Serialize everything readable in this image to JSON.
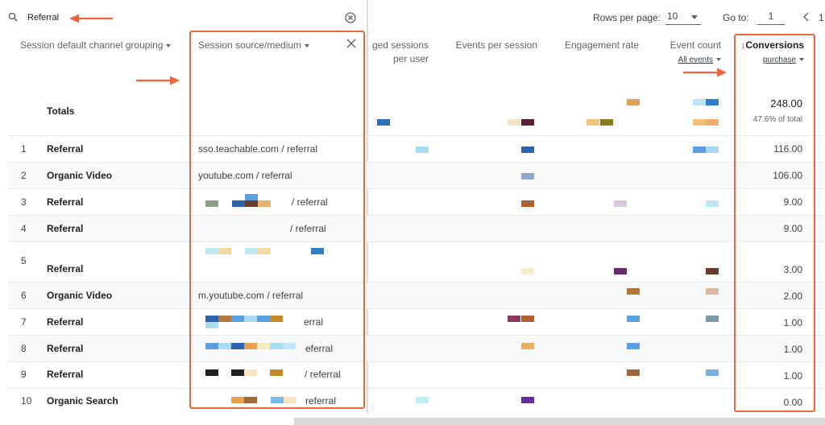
{
  "search": {
    "value": "Referral"
  },
  "pagination": {
    "rows_label": "Rows per page:",
    "rows_value": "10",
    "goto_label": "Go to:",
    "goto_value": "1",
    "page_fragment": "1"
  },
  "columns": {
    "channel": "Session default channel grouping",
    "source": "Session source/medium",
    "engaged_line1": "ged sessions",
    "engaged_line2": "per user",
    "events_per_session": "Events per session",
    "engagement_rate": "Engagement rate",
    "event_count": "Event count",
    "event_count_filter": "All events",
    "conversions": "Conversions",
    "conversions_filter": "purchase"
  },
  "totals": {
    "label": "Totals",
    "value": "248.00",
    "pct": "47.6% of total"
  },
  "rows": [
    {
      "rank": "1",
      "channel": "Referral",
      "source": "sso.teachable.com / referral",
      "conversions": "116.00"
    },
    {
      "rank": "2",
      "channel": "Organic Video",
      "source": "youtube.com / referral",
      "conversions": "106.00"
    },
    {
      "rank": "3",
      "channel": "Referral",
      "source": "/ referral",
      "conversions": "9.00"
    },
    {
      "rank": "4",
      "channel": "Referral",
      "source": "/ referral",
      "conversions": "9.00"
    },
    {
      "rank": "5",
      "channel": "Referral",
      "source": "",
      "conversions": "3.00"
    },
    {
      "rank": "6",
      "channel": "Organic Video",
      "source": "m.youtube.com / referral",
      "conversions": "2.00"
    },
    {
      "rank": "7",
      "channel": "Referral",
      "source": "erral",
      "conversions": "1.00"
    },
    {
      "rank": "8",
      "channel": "Referral",
      "source": "eferral",
      "conversions": "1.00"
    },
    {
      "rank": "9",
      "channel": "Referral",
      "source": "/ referral",
      "conversions": "1.00"
    },
    {
      "rank": "10",
      "channel": "Organic Search",
      "source": "referral",
      "conversions": "0.00"
    }
  ],
  "colors": {
    "annotation": "#f0643c",
    "header_text": "#5f6368",
    "row_shade": "#f8f9fa"
  },
  "icons": [
    "search-icon",
    "clear-icon",
    "chevron-left-icon",
    "close-icon",
    "sort-down-icon",
    "arrow-icon"
  ]
}
